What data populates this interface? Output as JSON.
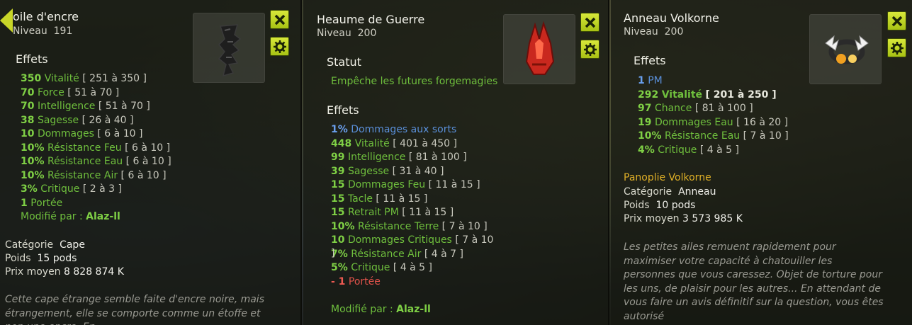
{
  "colors": {
    "effect_green": "#6fbf3d",
    "blue_stat": "#5a8fd9",
    "malus_red": "#e0524a",
    "panoply_gold": "#e0b027",
    "button_yellow": "#c8dc28"
  },
  "panel1": {
    "title": "oile d'encre",
    "level_label": "Niveau",
    "level": "191",
    "effects_header": "Effets",
    "effects": [
      {
        "value": "350",
        "name": "Vitalité",
        "range": "[ 251 à 350 ]"
      },
      {
        "value": "70",
        "name": "Force",
        "range": "[ 51 à 70 ]"
      },
      {
        "value": "70",
        "name": "Intelligence",
        "range": "[ 51 à 70 ]"
      },
      {
        "value": "38",
        "name": "Sagesse",
        "range": "[ 26 à 40 ]"
      },
      {
        "value": "10",
        "name": "Dommages",
        "range": "[ 6 à 10 ]"
      },
      {
        "value": "10%",
        "name": "Résistance Feu",
        "range": "[ 6 à 10 ]"
      },
      {
        "value": "10%",
        "name": "Résistance Eau",
        "range": "[ 6 à 10 ]"
      },
      {
        "value": "10%",
        "name": "Résistance Air",
        "range": "[ 6 à 10 ]"
      },
      {
        "value": "3%",
        "name": "Critique",
        "range": "[ 2 à 3 ]"
      },
      {
        "value": "1",
        "name": "Portée",
        "range": ""
      }
    ],
    "modified_label": "Modifié par :",
    "modified_by": "Alaz-ll",
    "category_label": "Catégorie",
    "category": "Cape",
    "weight_label": "Poids",
    "weight": "15 pods",
    "price_label": "Prix moyen",
    "price": "8 828 874 K",
    "description": "Cette cape étrange semble faite d'encre noire, mais étrangement, elle se comporte comme un étoffe et non une encre. En"
  },
  "panel2": {
    "title": "Heaume de Guerre",
    "level_label": "Niveau",
    "level": "200",
    "status_header": "Statut",
    "status_text": "Empêche les futures forgemagies",
    "effects_header": "Effets",
    "effects": [
      {
        "type": "blue",
        "value": "1%",
        "name": "Dommages aux sorts",
        "range": ""
      },
      {
        "type": "green",
        "value": "448",
        "name": "Vitalité",
        "range": "[ 401 à 450 ]"
      },
      {
        "type": "green",
        "value": "99",
        "name": "Intelligence",
        "range": "[ 81 à 100 ]"
      },
      {
        "type": "green",
        "value": "39",
        "name": "Sagesse",
        "range": "[ 31 à 40 ]"
      },
      {
        "type": "green",
        "value": "15",
        "name": "Dommages Feu",
        "range": "[ 11 à 15 ]"
      },
      {
        "type": "green",
        "value": "15",
        "name": "Tacle",
        "range": "[ 11 à 15 ]"
      },
      {
        "type": "green",
        "value": "15",
        "name": "Retrait PM",
        "range": "[ 11 à 15 ]"
      },
      {
        "type": "green",
        "value": "10%",
        "name": "Résistance Terre",
        "range": "[ 7 à 10 ]"
      },
      {
        "type": "green",
        "value": "10",
        "name": "Dommages Critiques",
        "range": "[ 7 à 10"
      },
      {
        "type": "green",
        "value": "7%",
        "name": "Résistance Air",
        "range": "[ 4 à 7 ]"
      },
      {
        "type": "green",
        "value": "5%",
        "name": "Critique",
        "range": "[ 4 à 5 ]"
      },
      {
        "type": "red",
        "value": "- 1",
        "name": "Portée",
        "range": ""
      }
    ],
    "range_overflow": "]",
    "modified_label": "Modifié par :",
    "modified_by": "Alaz-ll"
  },
  "panel3": {
    "title": "Anneau Volkorne",
    "level_label": "Niveau",
    "level": "200",
    "effects_header": "Effets",
    "effects": [
      {
        "type": "blue",
        "value": "1",
        "name": "PM",
        "range": ""
      },
      {
        "type": "green-bold",
        "value": "292",
        "name": "Vitalité",
        "range": "[ 201 à 250 ]"
      },
      {
        "type": "green",
        "value": "97",
        "name": "Chance",
        "range": "[ 81 à 100 ]"
      },
      {
        "type": "green",
        "value": "19",
        "name": "Dommages Eau",
        "range": "[ 16 à 20 ]"
      },
      {
        "type": "green",
        "value": "10%",
        "name": "Résistance Eau",
        "range": "[ 7 à 10 ]"
      },
      {
        "type": "green",
        "value": "4%",
        "name": "Critique",
        "range": "[ 4 à 5 ]"
      }
    ],
    "panoply": "Panoplie Volkorne",
    "category_label": "Catégorie",
    "category": "Anneau",
    "weight_label": "Poids",
    "weight": "10 pods",
    "price_label": "Prix moyen",
    "price": "3 573 985 K",
    "description": "Les petites ailes remuent rapidement pour maximiser votre capacité à chatouiller les personnes que vous caressez. Objet de torture pour les uns, de plaisir pour les autres... En attendant de vous faire un avis définitif sur la question, vous êtes autorisé"
  },
  "icons": {
    "close": "close-icon",
    "settings": "gear-icon",
    "back": "back-arrow-icon"
  }
}
